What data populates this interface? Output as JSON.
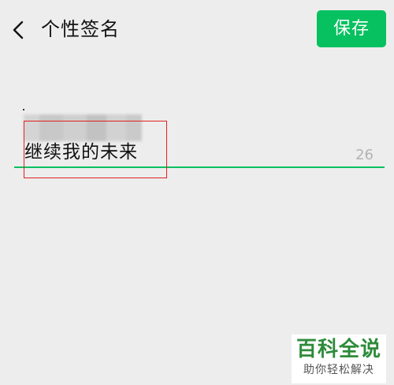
{
  "header": {
    "title": "个性签名",
    "save_label": "保存"
  },
  "signature": {
    "value": "继续我的未来",
    "remaining_count": "26"
  },
  "watermark": {
    "title": "百科全说",
    "subtitle": "助你轻松解决"
  },
  "colors": {
    "accent_green": "#07c160",
    "background": "#ededed",
    "annotation_red": "#e02020"
  },
  "icons": {
    "back": "chevron-left-icon"
  }
}
